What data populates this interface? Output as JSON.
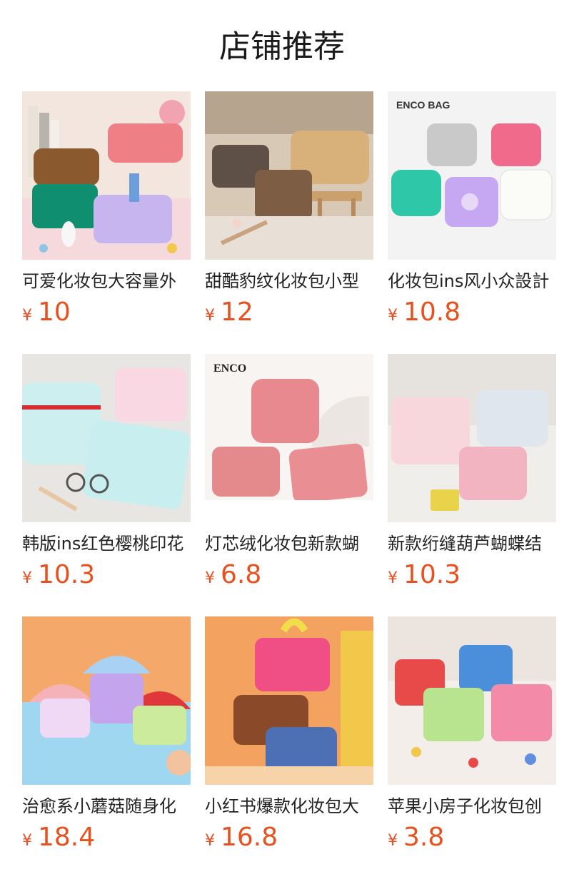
{
  "section_title": "店铺推荐",
  "currency": "¥",
  "products": [
    {
      "name": "可爱化妆包大容量外",
      "price": "10"
    },
    {
      "name": "甜酷豹纹化妆包小型",
      "price": "12"
    },
    {
      "name": "化妆包ins风小众設計",
      "price": "10.8",
      "image_text": "ENCO BAG"
    },
    {
      "name": "韩版ins红色樱桃印花",
      "price": "10.3"
    },
    {
      "name": "灯芯绒化妆包新款蝴",
      "price": "6.8",
      "image_text": "ENCO"
    },
    {
      "name": "新款绗缝葫芦蝴蝶结",
      "price": "10.3"
    },
    {
      "name": "治愈系小蘑菇随身化",
      "price": "18.4"
    },
    {
      "name": "小红书爆款化妆包大",
      "price": "16.8"
    },
    {
      "name": "苹果小房子化妆包创",
      "price": "3.8"
    }
  ]
}
